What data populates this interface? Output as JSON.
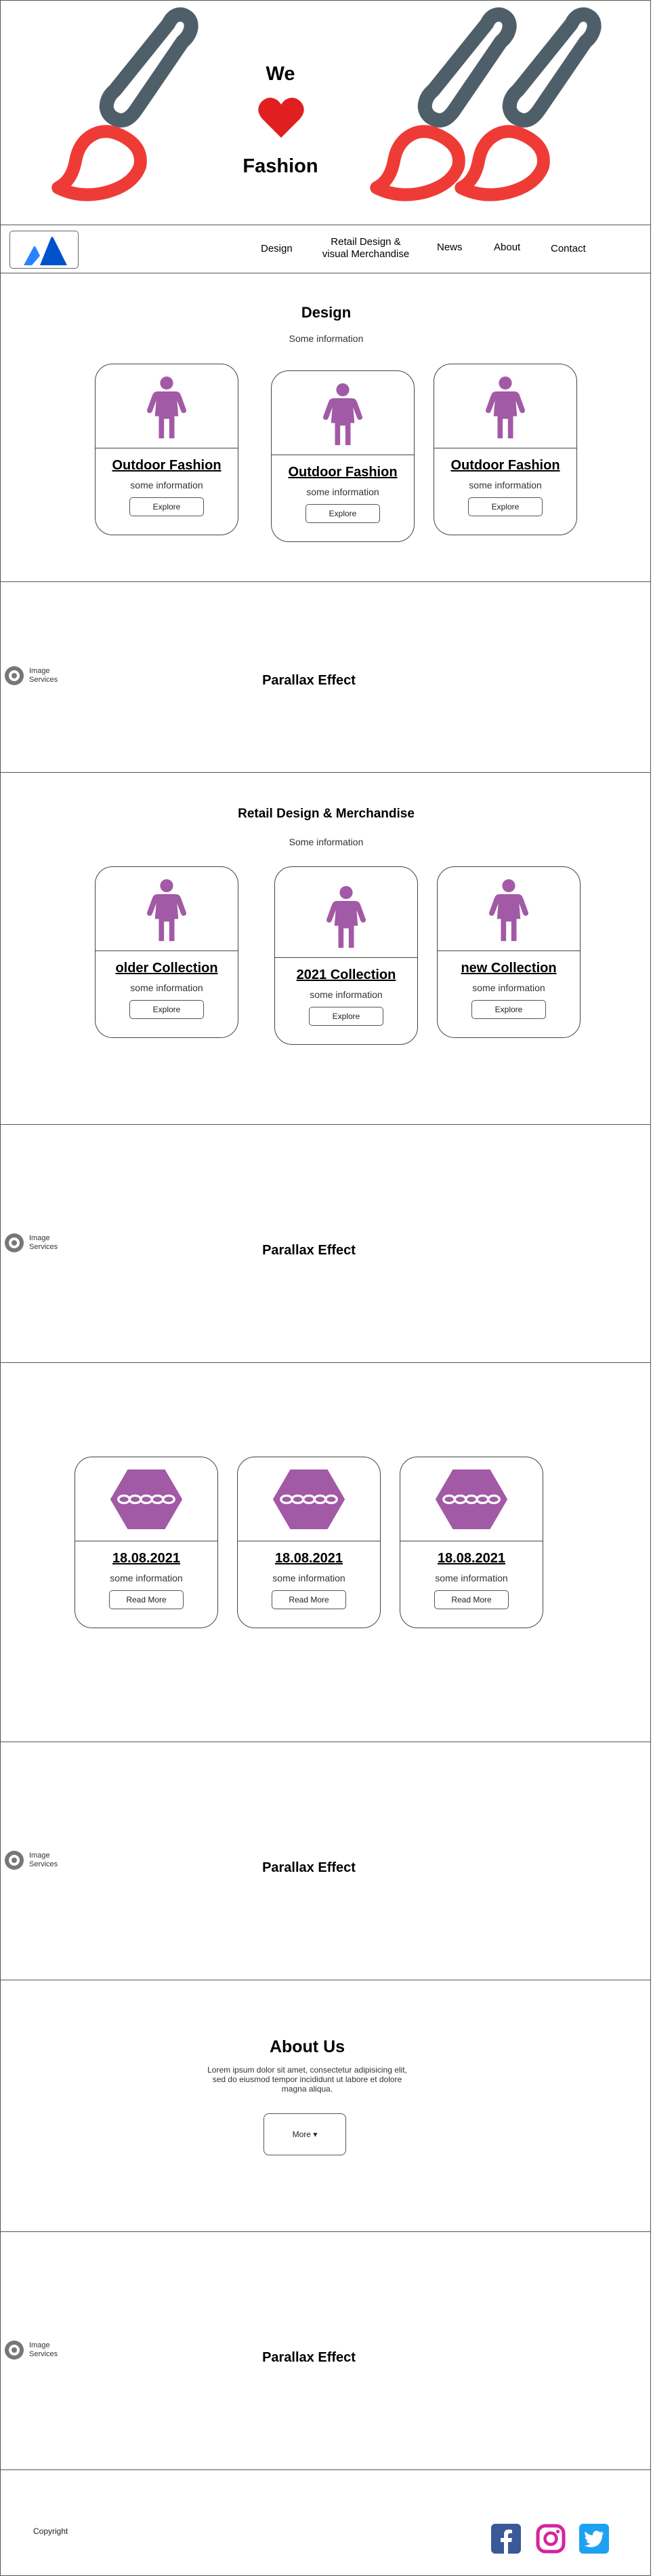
{
  "hero": {
    "line1": "We",
    "line2": "Fashion",
    "heart_icon": "heart-icon",
    "brush_icon": "paintbrush-icon"
  },
  "nav": {
    "logo_icon": "atlassian-logo",
    "links": [
      "Design",
      "Retail Design &",
      "visual Merchandise",
      "News",
      "About",
      "Contact"
    ]
  },
  "design": {
    "title": "Design",
    "subtitle": "Some information",
    "cards": [
      {
        "title": "Outdoor Fashion",
        "info": "some information",
        "button": "Explore",
        "icon": "woman-icon"
      },
      {
        "title": "Outdoor Fashion",
        "info": "some information",
        "button": "Explore",
        "icon": "woman-icon"
      },
      {
        "title": "Outdoor Fashion",
        "info": "some information",
        "button": "Explore",
        "icon": "woman-icon"
      }
    ]
  },
  "parallax": {
    "title": "Parallax Effect",
    "image_label_1": "Image",
    "image_label_2": "Services"
  },
  "retail": {
    "title": "Retail Design & Merchandise",
    "subtitle": "Some information",
    "cards": [
      {
        "title": "older Collection",
        "info": "some information",
        "button": "Explore",
        "icon": "woman-icon"
      },
      {
        "title": "2021 Collection",
        "info": "some information",
        "button": "Explore",
        "icon": "woman-icon"
      },
      {
        "title": "new Collection",
        "info": "some information",
        "button": "Explore",
        "icon": "woman-icon"
      }
    ]
  },
  "news": {
    "cards": [
      {
        "date": "18.08.2021",
        "info": "some information",
        "button": "Read More",
        "icon": "hexagon-chain-icon"
      },
      {
        "date": "18.08.2021",
        "info": "some information",
        "button": "Read More",
        "icon": "hexagon-chain-icon"
      },
      {
        "date": "18.08.2021",
        "info": "some information",
        "button": "Read More",
        "icon": "hexagon-chain-icon"
      }
    ]
  },
  "about": {
    "title": "About Us",
    "text_1": "Lorem ipsum dolor sit amet, consectetur adipisicing elit,",
    "text_2": "sed do eiusmod tempor incididunt ut labore et dolore",
    "text_3": "magna aliqua.",
    "button": "More ▾"
  },
  "footer": {
    "copyright": "Copyright",
    "social_icons": [
      "facebook-icon",
      "instagram-icon",
      "twitter-icon"
    ]
  },
  "colors": {
    "brush_handle": "#4f5f6a",
    "brush_paint": "#ef3b36",
    "heart": "#e02020",
    "purple": "#a259a6",
    "logo_blue": "#2684ff",
    "facebook": "#3b5998",
    "instagram": "#d6249f",
    "twitter": "#1da1f2"
  }
}
